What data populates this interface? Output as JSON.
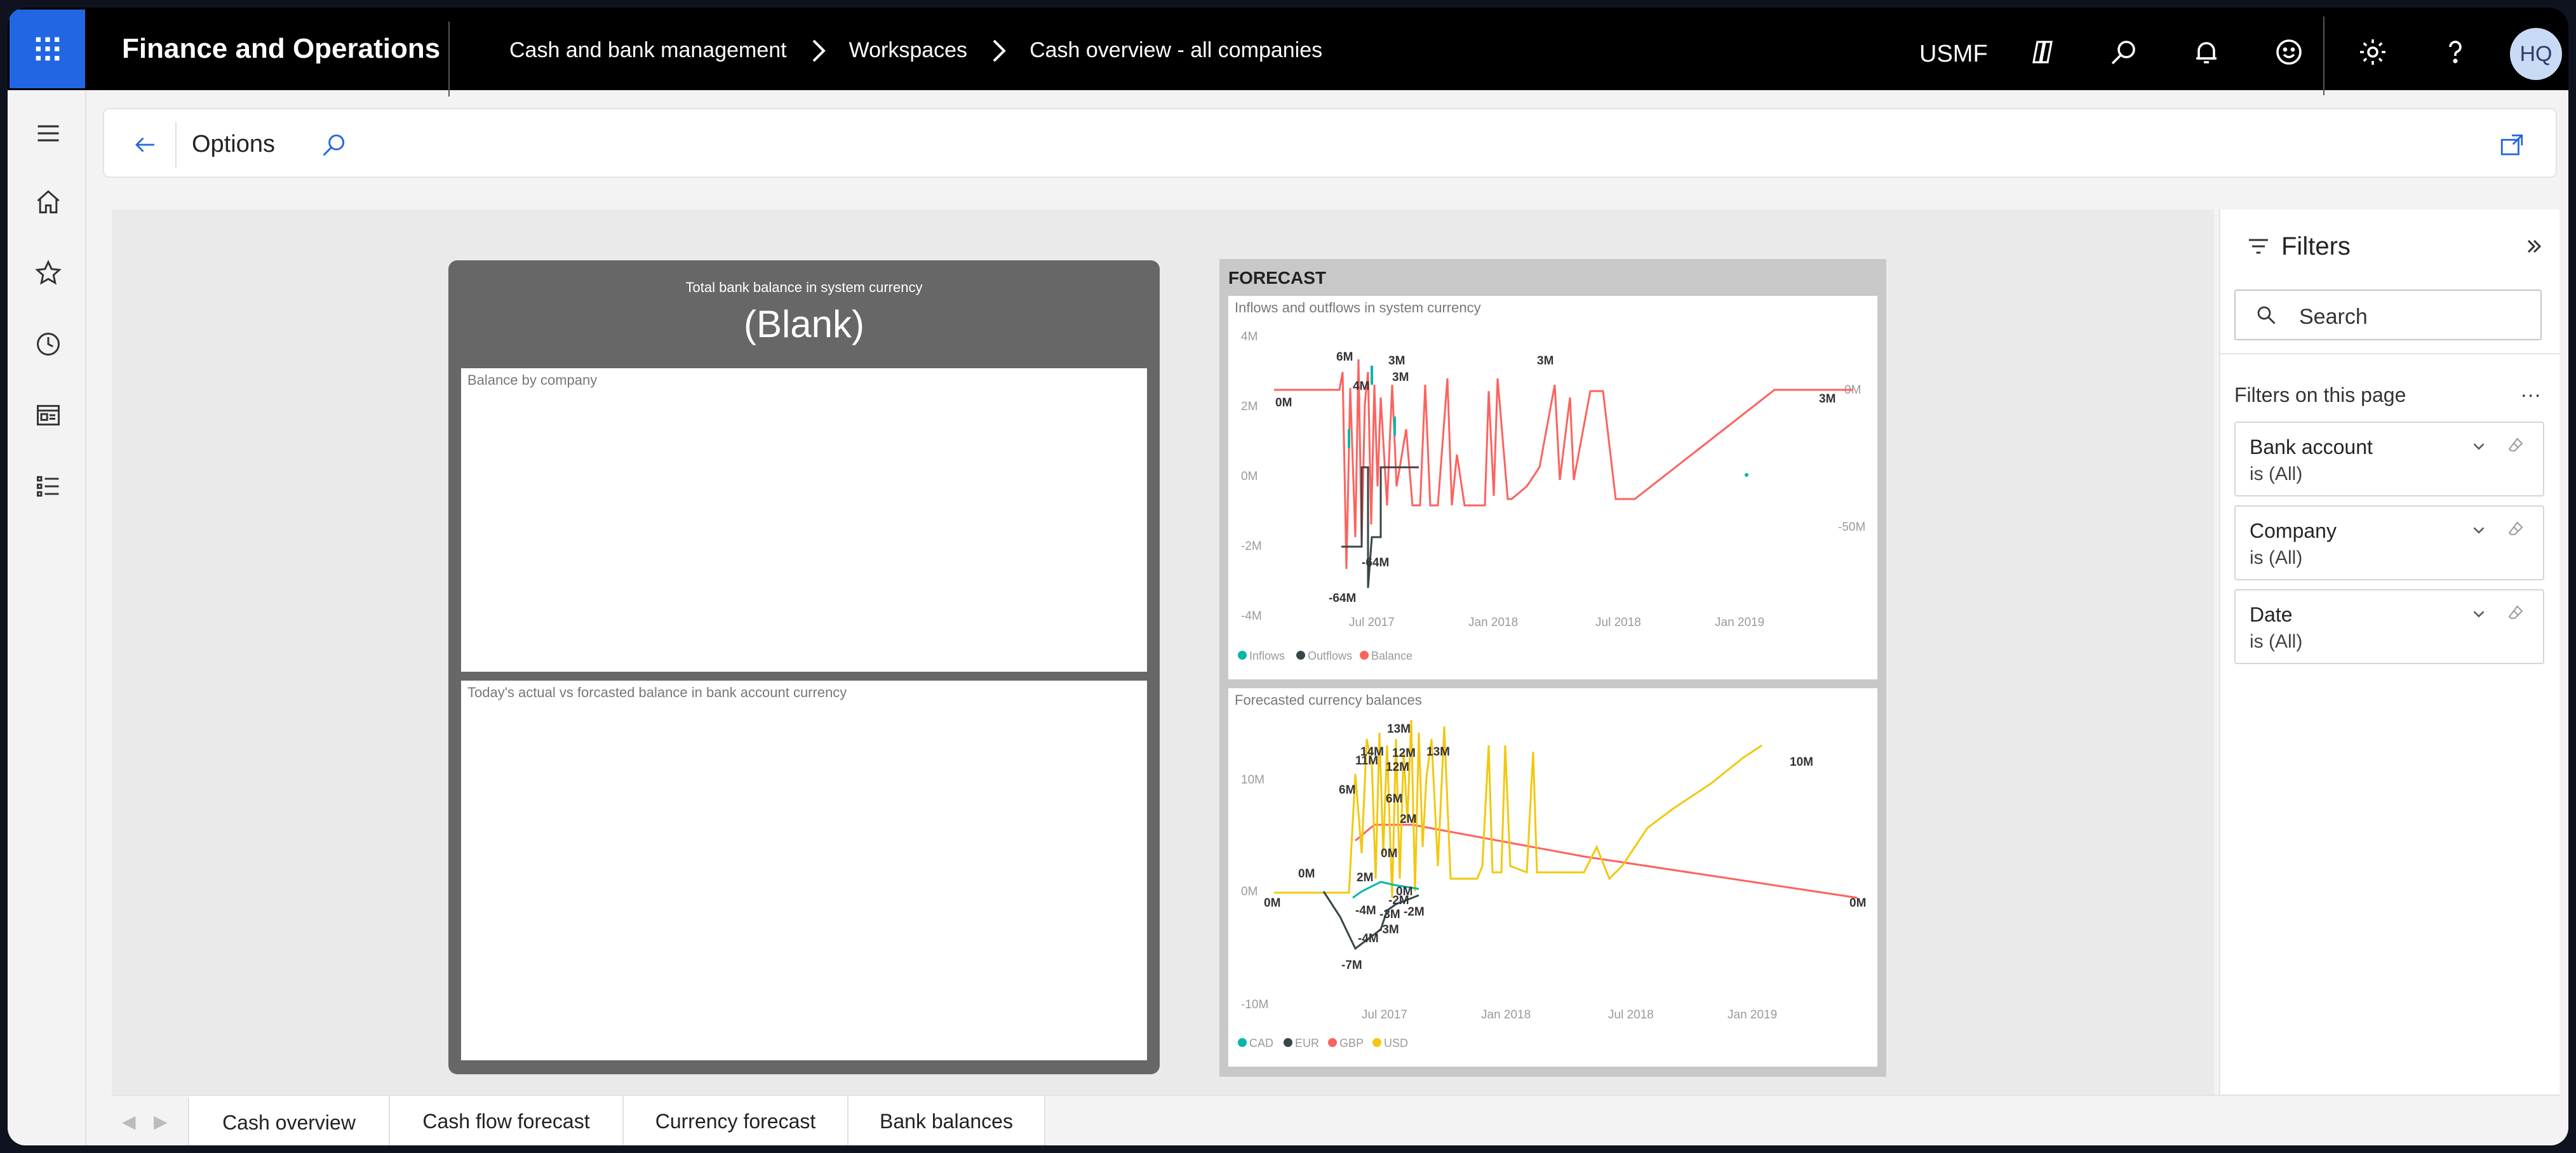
{
  "app": {
    "title": "Finance and Operations"
  },
  "breadcrumb": [
    "Cash and bank management",
    "Workspaces",
    "Cash overview - all companies"
  ],
  "topbar": {
    "company": "USMF",
    "avatar_initials": "HQ"
  },
  "actionbar": {
    "options_label": "Options"
  },
  "left_panel": {
    "kpi_title": "Total bank balance in system currency",
    "kpi_value": "(Blank)",
    "card1_title": "Balance by company",
    "card2_title": "Today's actual vs forcasted balance in bank account currency"
  },
  "forecast_panel": {
    "label": "FORECAST",
    "chart1": {
      "title": "Inflows and outflows in system currency",
      "y_ticks": [
        "4M",
        "2M",
        "0M",
        "-2M",
        "-4M"
      ],
      "y2_ticks": [
        "0M",
        "-50M"
      ],
      "x_ticks": [
        "Jul 2017",
        "Jan 2018",
        "Jul 2018",
        "Jan 2019"
      ],
      "legend": [
        "Inflows",
        "Outflows",
        "Balance"
      ]
    },
    "chart2": {
      "title": "Forecasted currency balances",
      "y_ticks": [
        "10M",
        "0M",
        "-10M"
      ],
      "x_ticks": [
        "Jul 2017",
        "Jan 2018",
        "Jul 2018",
        "Jan 2019"
      ],
      "legend": [
        "CAD",
        "EUR",
        "GBP",
        "USD"
      ]
    }
  },
  "chart_data": [
    {
      "type": "line",
      "title": "Inflows and outflows in system currency",
      "x": [
        "Jul 2017",
        "Jan 2018",
        "Jul 2018",
        "Jan 2019"
      ],
      "series": [
        {
          "name": "Inflows",
          "color": "#01b8aa"
        },
        {
          "name": "Outflows",
          "color": "#374649"
        },
        {
          "name": "Balance",
          "color": "#fd625e"
        }
      ],
      "ylim": [
        -4,
        4
      ],
      "y_unit": "M",
      "data_labels": [
        "6M",
        "4M",
        "3M",
        "3M",
        "3M",
        "3M",
        "0M",
        "-64M",
        "-64M"
      ]
    },
    {
      "type": "line",
      "title": "Forecasted currency balances",
      "x": [
        "Jul 2017",
        "Jan 2018",
        "Jul 2018",
        "Jan 2019"
      ],
      "series": [
        {
          "name": "CAD",
          "color": "#01b8aa"
        },
        {
          "name": "EUR",
          "color": "#374649"
        },
        {
          "name": "GBP",
          "color": "#fd625e"
        },
        {
          "name": "USD",
          "color": "#f2c80f"
        }
      ],
      "ylim": [
        -10,
        10
      ],
      "y_unit": "M",
      "data_labels": [
        "13M",
        "14M",
        "12M",
        "11M",
        "12M",
        "13M",
        "10M",
        "6M",
        "6M",
        "2M",
        "2M",
        "0M",
        "0M",
        "0M",
        "0M",
        "0M",
        "-2M",
        "-2M",
        "-3M",
        "-3M",
        "-4M",
        "-4M",
        "-7M"
      ]
    }
  ],
  "filters": {
    "title": "Filters",
    "search_placeholder": "Search",
    "section_label": "Filters on this page",
    "more": "...",
    "items": [
      {
        "name": "Bank account",
        "value": "is (All)"
      },
      {
        "name": "Company",
        "value": "is (All)"
      },
      {
        "name": "Date",
        "value": "is (All)"
      }
    ]
  },
  "tabs": [
    "Cash overview",
    "Cash flow forecast",
    "Currency forecast",
    "Bank balances"
  ],
  "colors": {
    "accent": "#2266e3",
    "inflows": "#01b8aa",
    "outflows": "#374649",
    "balance": "#fd625e",
    "usd": "#f2c80f"
  }
}
